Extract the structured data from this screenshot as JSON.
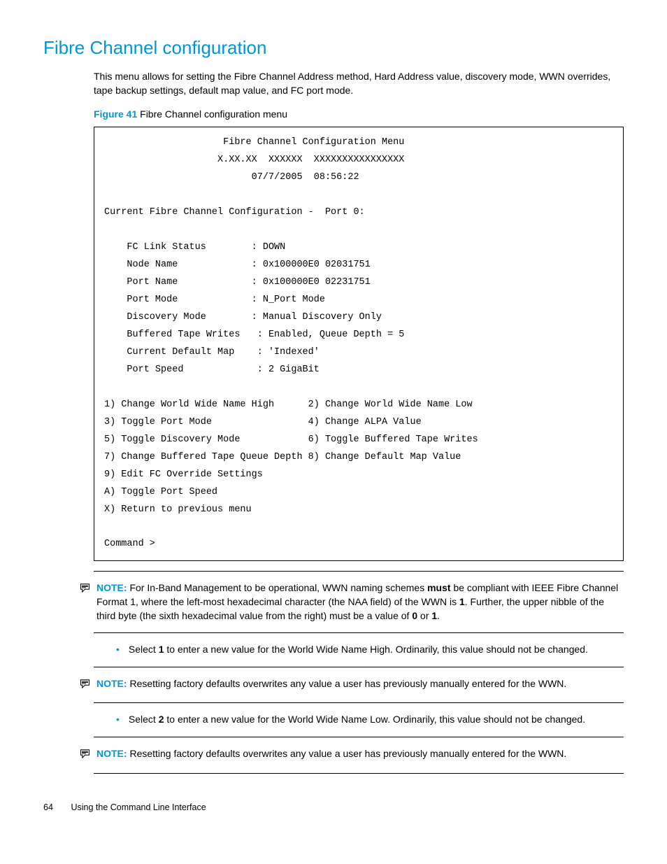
{
  "heading": "Fibre Channel configuration",
  "intro": "This menu allows for setting the Fibre Channel Address method, Hard Address value, discovery mode, WWN overrides, tape backup settings, default map value, and FC port mode.",
  "figure": {
    "label": "Figure 41",
    "caption": "Fibre Channel configuration menu"
  },
  "terminal": "                     Fibre Channel Configuration Menu\n                    X.XX.XX  XXXXXX  XXXXXXXXXXXXXXXX\n                          07/7/2005  08:56:22\n\nCurrent Fibre Channel Configuration -  Port 0:\n\n    FC Link Status        : DOWN\n    Node Name             : 0x100000E0 02031751\n    Port Name             : 0x100000E0 02231751\n    Port Mode             : N_Port Mode\n    Discovery Mode        : Manual Discovery Only\n    Buffered Tape Writes   : Enabled, Queue Depth = 5\n    Current Default Map    : 'Indexed'\n    Port Speed             : 2 GigaBit\n\n1) Change World Wide Name High      2) Change World Wide Name Low\n3) Toggle Port Mode                 4) Change ALPA Value\n5) Toggle Discovery Mode            6) Toggle Buffered Tape Writes\n7) Change Buffered Tape Queue Depth 8) Change Default Map Value\n9) Edit FC Override Settings\nA) Toggle Port Speed\nX) Return to previous menu\n\nCommand >",
  "note1": {
    "label": "NOTE:",
    "pre": "For In-Band Management to be operational, WWN naming schemes ",
    "bold1": "must",
    "mid": " be compliant with IEEE Fibre Channel Format 1, where the left-most hexadecimal character (the NAA field) of the WWN is ",
    "bold2": "1",
    "post1": ". Further, the upper nibble of the third byte (the sixth hexadecimal value from the right) must be a value of ",
    "bold3": "0",
    "or": " or ",
    "bold4": "1",
    "post2": "."
  },
  "bullet1": {
    "pre": "Select ",
    "bold": "1",
    "post": " to enter a new value for the World Wide Name High. Ordinarily, this value should not be changed."
  },
  "note2": {
    "label": "NOTE:",
    "text": "Resetting factory defaults overwrites any value a user has previously manually entered for the WWN."
  },
  "bullet2": {
    "pre": "Select ",
    "bold": "2",
    "post": " to enter a new value for the World Wide Name Low. Ordinarily, this value should not be changed."
  },
  "note3": {
    "label": "NOTE:",
    "text": "Resetting factory defaults overwrites any value a user has previously manually entered for the WWN."
  },
  "footer": {
    "page": "64",
    "section": "Using the Command Line Interface"
  }
}
